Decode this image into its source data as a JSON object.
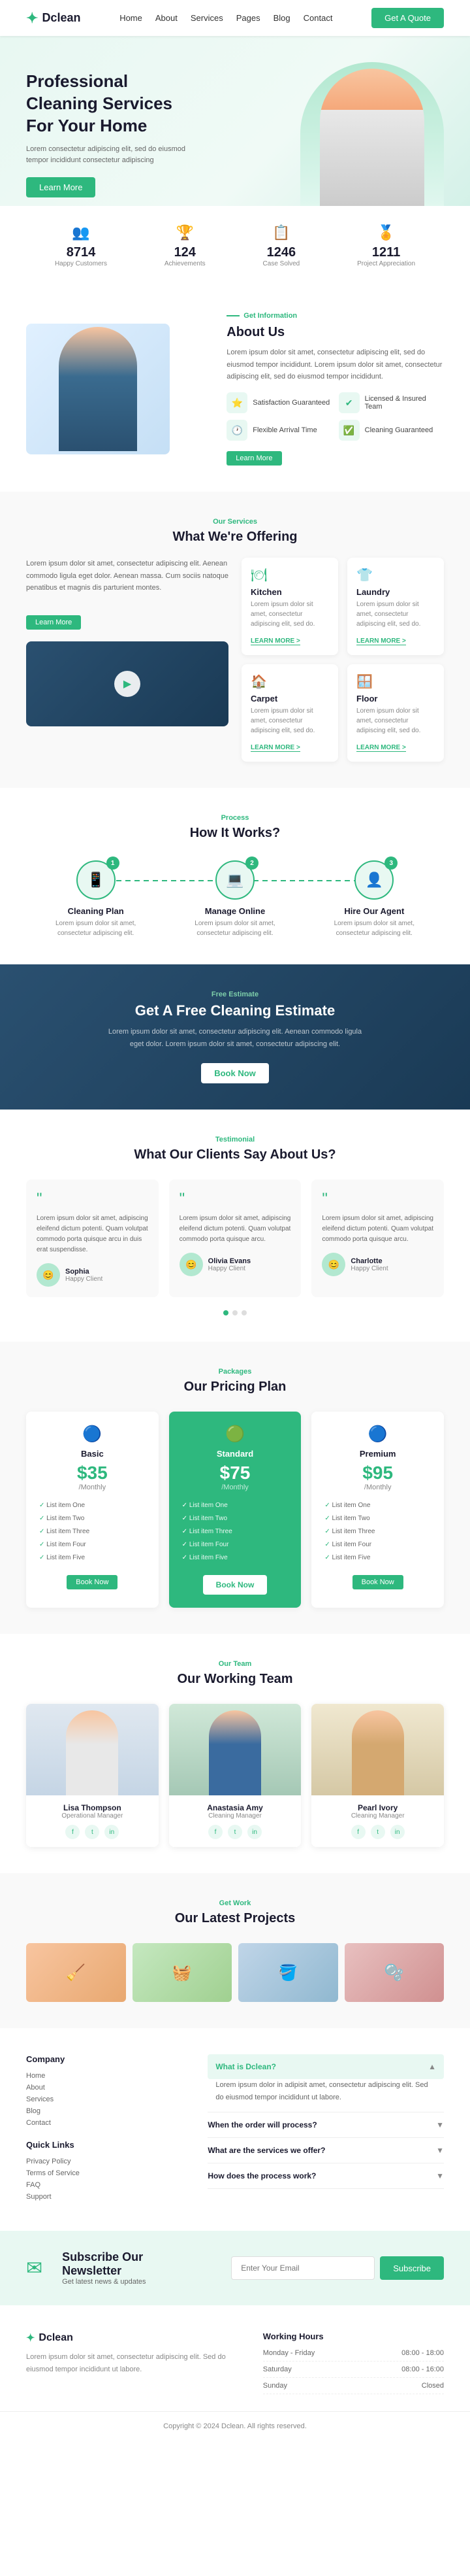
{
  "brand": {
    "name": "Dclean",
    "logo_icon": "✦"
  },
  "nav": {
    "links": [
      "Home",
      "About",
      "Services",
      "Pages",
      "Blog",
      "Contact"
    ],
    "cta_label": "Get A Quote"
  },
  "hero": {
    "title": "Professional\nCleaning Services\nFor Your Home",
    "subtitle": "Lorem consectetur adipiscing elit, sed do eiusmod tempor incididunt consectetur adipiscing",
    "cta_label": "Learn More"
  },
  "stats": [
    {
      "icon": "👥",
      "number": "8714",
      "label": "Happy Customers"
    },
    {
      "icon": "🏆",
      "number": "124",
      "label": "Achievements"
    },
    {
      "icon": "📋",
      "number": "1246",
      "label": "Case Solved"
    },
    {
      "icon": "🏅",
      "number": "1211",
      "label": "Project Appreciation"
    }
  ],
  "about": {
    "section_tag": "Get Information",
    "title": "About Us",
    "description": "Lorem ipsum dolor sit amet, consectetur adipiscing elit, sed do eiusmod tempor incididunt. Lorem ipsum dolor sit amet, consectetur adipiscing elit, sed do eiusmod tempor incididunt.",
    "features": [
      {
        "icon": "⭐",
        "title": "Satisfaction Guaranteed"
      },
      {
        "icon": "✔",
        "title": "Licensed & Insured Team"
      },
      {
        "icon": "🕐",
        "title": "Flexible Arrival Time"
      },
      {
        "icon": "✅",
        "title": "Cleaning Guaranteed"
      }
    ],
    "cta_label": "Learn More"
  },
  "services": {
    "section_tag": "Our Services",
    "title": "What We're Offering",
    "description": "Lorem ipsum dolor sit amet, consectetur adipiscing elit. Aenean commodo ligula eget dolor. Aenean massa. Cum sociis natoque penatibus et magnis dis parturient montes.",
    "video_label": "Watch Video",
    "cards": [
      {
        "icon": "🍽",
        "title": "Kitchen",
        "description": "Lorem ipsum dolor sit amet, consectetur adipiscing elit, sed do."
      },
      {
        "icon": "👕",
        "title": "Laundry",
        "description": "Lorem ipsum dolor sit amet, consectetur adipiscing elit, sed do."
      },
      {
        "icon": "🏠",
        "title": "Carpet",
        "description": "Lorem ipsum dolor sit amet, consectetur adipiscing elit, sed do."
      },
      {
        "icon": "🪟",
        "title": "Floor",
        "description": "Lorem ipsum dolor sit amet, consectetur adipiscing elit, sed do."
      }
    ],
    "learn_more_label": "LEARN MORE >"
  },
  "how_it_works": {
    "section_tag": "Process",
    "title": "How It Works?",
    "steps": [
      {
        "icon": "📱",
        "number": "1",
        "title": "Cleaning Plan",
        "description": "Lorem ipsum dolor sit amet, consectetur adipiscing elit."
      },
      {
        "icon": "💻",
        "number": "2",
        "title": "Manage Online",
        "description": "Lorem ipsum dolor sit amet, consectetur adipiscing elit."
      },
      {
        "icon": "👤",
        "number": "3",
        "title": "Hire Our Agent",
        "description": "Lorem ipsum dolor sit amet, consectetur adipiscing elit."
      }
    ]
  },
  "estimate": {
    "section_tag": "Free Estimate",
    "title": "Get A Free Cleaning Estimate",
    "description": "Lorem ipsum dolor sit amet, consectetur adipiscing elit. Aenean commodo ligula eget dolor. Lorem ipsum dolor sit amet, consectetur adipiscing elit.",
    "cta_label": "Book Now"
  },
  "testimonials": {
    "section_tag": "Testimonial",
    "title": "What Our Clients Say About Us?",
    "items": [
      {
        "quote": "Lorem ipsum dolor sit amet, adipiscing eleifend dictum potenti. Quam volutpat commodo porta quisque arcu in duis erat suspendisse.",
        "name": "Sophia",
        "role": "Happy Client"
      },
      {
        "quote": "Lorem ipsum dolor sit amet, adipiscing eleifend dictum potenti. Quam volutpat commodo porta quisque arcu.",
        "name": "Olivia Evans",
        "role": "Happy Client"
      },
      {
        "quote": "Lorem ipsum dolor sit amet, adipiscing eleifend dictum potenti. Quam volutpat commodo porta quisque arcu.",
        "name": "Charlotte",
        "role": "Happy Client"
      }
    ]
  },
  "pricing": {
    "section_tag": "Packages",
    "title": "Our Pricing Plan",
    "plans": [
      {
        "icon": "🔵",
        "name": "Basic",
        "price": "$35",
        "period": "/Monthly",
        "features": [
          "List item One",
          "List item Two",
          "List item Three",
          "List item Four",
          "List item Five"
        ],
        "cta": "Book Now",
        "featured": false
      },
      {
        "icon": "🟢",
        "name": "Standard",
        "price": "$75",
        "period": "/Monthly",
        "features": [
          "List item One",
          "List item Two",
          "List item Three",
          "List item Four",
          "List item Five"
        ],
        "cta": "Book Now",
        "featured": true
      },
      {
        "icon": "🔵",
        "name": "Premium",
        "price": "$95",
        "period": "/Monthly",
        "features": [
          "List item One",
          "List item Two",
          "List item Three",
          "List item Four",
          "List item Five"
        ],
        "cta": "Book Now",
        "featured": false
      }
    ]
  },
  "team": {
    "section_tag": "Our Team",
    "title": "Our Working Team",
    "members": [
      {
        "name": "Lisa Thompson",
        "role": "Operational Manager"
      },
      {
        "name": "Anastasia Amy",
        "role": "Cleaning Manager"
      },
      {
        "name": "Pearl Ivory",
        "role": "Cleaning Manager"
      }
    ]
  },
  "projects": {
    "section_tag": "Get Work",
    "title": "Our Latest Projects"
  },
  "faq": {
    "active_question": "What is Dclean?",
    "active_answer": "Lorem ipsum dolor in adipisit amet, consectetur adipiscing elit. Sed do eiusmod tempor incididunt ut labore.",
    "items": [
      {
        "question": "What is Dclean?",
        "active": true
      },
      {
        "question": "When the order will process?",
        "active": false
      },
      {
        "question": "What are the services we offer?",
        "active": false
      },
      {
        "question": "How does the process work?",
        "active": false
      }
    ]
  },
  "footer_links": [
    {
      "title": "Company",
      "links": [
        "Home",
        "About",
        "Services",
        "Blog",
        "Contact"
      ]
    },
    {
      "title": "Quick Links",
      "links": [
        "Privacy Policy",
        "Terms of Service",
        "FAQ",
        "Support"
      ]
    }
  ],
  "newsletter": {
    "title": "Subscribe Our\nNewsletter",
    "subtitle": "Get latest news & updates",
    "placeholder": "Enter Your Email",
    "cta_label": "Subscribe"
  },
  "footer_brand": {
    "description": "Lorem ipsum dolor sit amet, consectetur adipiscing elit. Sed do eiusmod tempor incididunt ut labore."
  },
  "working_hours": {
    "title": "Working Hours",
    "hours": [
      {
        "day": "Monday - Friday",
        "time": "08:00 - 18:00"
      },
      {
        "day": "Saturday",
        "time": "08:00 - 16:00"
      },
      {
        "day": "Sunday",
        "time": "Closed"
      }
    ]
  },
  "copyright": "Copyright © 2024 Dclean. All rights reserved."
}
